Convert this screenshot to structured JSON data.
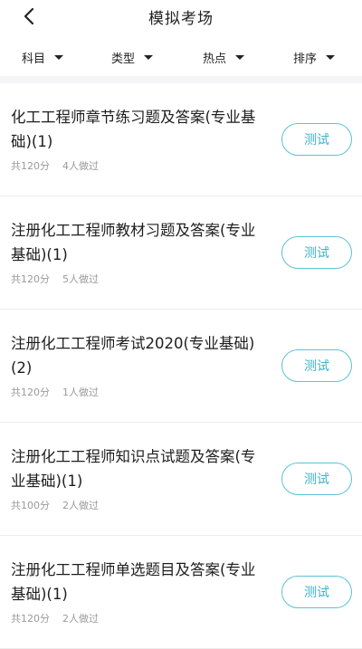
{
  "header": {
    "title": "模拟考场"
  },
  "filters": [
    {
      "label": "科目"
    },
    {
      "label": "类型"
    },
    {
      "label": "热点"
    },
    {
      "label": "排序"
    }
  ],
  "items": [
    {
      "title": "化工工程师章节练习题及答案(专业基础)(1)",
      "score": "共120分",
      "takers": "4人做过",
      "button": "测试"
    },
    {
      "title": "注册化工工程师教材习题及答案(专业基础)(1)",
      "score": "共120分",
      "takers": "5人做过",
      "button": "测试"
    },
    {
      "title": "注册化工工程师考试2020(专业基础)(2)",
      "score": "共120分",
      "takers": "1人做过",
      "button": "测试"
    },
    {
      "title": "注册化工工程师知识点试题及答案(专业基础)(1)",
      "score": "共100分",
      "takers": "2人做过",
      "button": "测试"
    },
    {
      "title": "注册化工工程师单选题目及答案(专业基础)(1)",
      "score": "共120分",
      "takers": "2人做过",
      "button": "测试"
    }
  ]
}
